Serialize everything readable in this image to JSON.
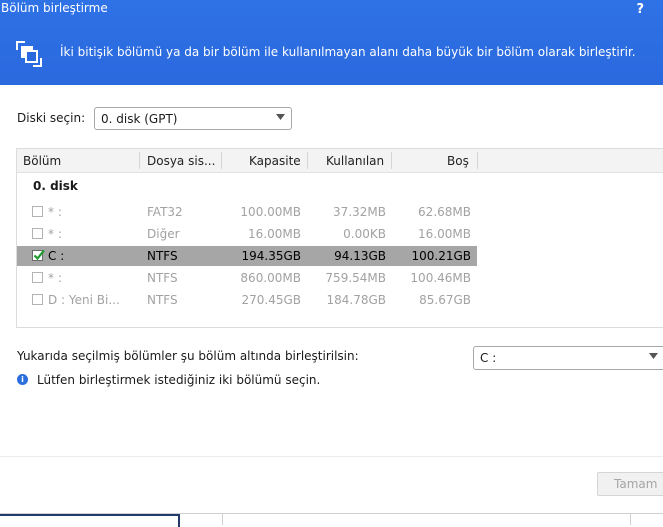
{
  "window": {
    "title": "Bölüm birleştirme",
    "help": "?"
  },
  "header": {
    "description": "İki bitişik bölümü ya da bir bölüm ile kullanılmayan alanı daha büyük bir bölüm olarak birleştirir."
  },
  "disk_select": {
    "label": "Diski seçin:",
    "value": "0. disk (GPT)"
  },
  "table": {
    "columns": [
      "Bölüm",
      "Dosya sis...",
      "Kapasite",
      "Kullanılan",
      "Boş"
    ],
    "group": "0. disk",
    "rows": [
      {
        "name": "* :",
        "fs": "FAT32",
        "capacity": "100.00MB",
        "used": "37.32MB",
        "free": "62.68MB",
        "checked": false,
        "selected": false
      },
      {
        "name": "* :",
        "fs": "Diğer",
        "capacity": "16.00MB",
        "used": "0.00KB",
        "free": "16.00MB",
        "checked": false,
        "selected": false
      },
      {
        "name": "C :",
        "fs": "NTFS",
        "capacity": "194.35GB",
        "used": "94.13GB",
        "free": "100.21GB",
        "checked": true,
        "selected": true
      },
      {
        "name": "* :",
        "fs": "NTFS",
        "capacity": "860.00MB",
        "used": "759.54MB",
        "free": "100.46MB",
        "checked": false,
        "selected": false
      },
      {
        "name": "D :  Yeni Bi...",
        "fs": "NTFS",
        "capacity": "270.45GB",
        "used": "184.78GB",
        "free": "85.67GB",
        "checked": false,
        "selected": false
      }
    ]
  },
  "merge_target": {
    "label": "Yukarıda seçilmiş bölümler şu bölüm altında birleştirilsin:",
    "value": "C :"
  },
  "info": {
    "text": "Lütfen birleştirmek istediğiniz iki bölümü seçin."
  },
  "buttons": {
    "ok": "Tamam"
  },
  "colors": {
    "header": "#2a68de",
    "selected_row": "#a6a6a6",
    "check": "#1f9a2e"
  }
}
